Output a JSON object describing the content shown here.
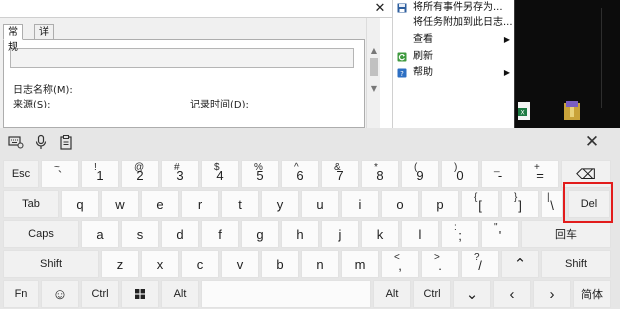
{
  "event_viewer": {
    "close_glyph": "✕",
    "tabs": [
      {
        "label": "常规",
        "active": true
      },
      {
        "label": "详细信息",
        "active": false
      }
    ],
    "fields": [
      {
        "label": "日志名称(M):"
      },
      {
        "label": "来源(S):"
      },
      {
        "label": "记录时间(D):"
      }
    ],
    "menu": [
      {
        "label": "将所有事件另存为...",
        "icon": "save-icon"
      },
      {
        "label": "将任务附加到此日志...",
        "icon": "none"
      },
      {
        "label": "查看",
        "icon": "none",
        "submenu": true
      },
      {
        "label": "刷新",
        "icon": "refresh-icon"
      },
      {
        "label": "帮助",
        "icon": "help-icon",
        "submenu": true
      }
    ]
  },
  "keyboard": {
    "close_glyph": "✕",
    "toolbar_icons": [
      "keyboard-settings-icon",
      "microphone-icon",
      "clipboard-icon"
    ],
    "rows": [
      [
        {
          "label": "Esc"
        },
        {
          "shift": "~",
          "label": "`"
        },
        {
          "shift": "!",
          "label": "1"
        },
        {
          "shift": "@",
          "label": "2"
        },
        {
          "shift": "#",
          "label": "3"
        },
        {
          "shift": "$",
          "label": "4"
        },
        {
          "shift": "%",
          "label": "5"
        },
        {
          "shift": "^",
          "label": "6"
        },
        {
          "shift": "&",
          "label": "7"
        },
        {
          "shift": "*",
          "label": "8"
        },
        {
          "shift": "(",
          "label": "9"
        },
        {
          "shift": ")",
          "label": "0"
        },
        {
          "shift": "_",
          "label": "-"
        },
        {
          "shift": "+",
          "label": "="
        },
        {
          "label": "⌫",
          "icon": "backspace-icon"
        }
      ],
      [
        {
          "label": "Tab"
        },
        {
          "label": "q"
        },
        {
          "label": "w"
        },
        {
          "label": "e"
        },
        {
          "label": "r"
        },
        {
          "label": "t"
        },
        {
          "label": "y"
        },
        {
          "label": "u"
        },
        {
          "label": "i"
        },
        {
          "label": "o"
        },
        {
          "label": "p"
        },
        {
          "shift": "{",
          "label": "["
        },
        {
          "shift": "}",
          "label": "]"
        },
        {
          "shift": "|",
          "label": "\\"
        },
        {
          "label": "Del"
        }
      ],
      [
        {
          "label": "Caps"
        },
        {
          "label": "a"
        },
        {
          "label": "s"
        },
        {
          "label": "d"
        },
        {
          "label": "f"
        },
        {
          "label": "g"
        },
        {
          "label": "h"
        },
        {
          "label": "j"
        },
        {
          "label": "k"
        },
        {
          "label": "l"
        },
        {
          "shift": ":",
          "label": ";"
        },
        {
          "shift": "\"",
          "label": "'"
        },
        {
          "label": "回车"
        }
      ],
      [
        {
          "label": "Shift"
        },
        {
          "label": "z"
        },
        {
          "label": "x"
        },
        {
          "label": "c"
        },
        {
          "label": "v"
        },
        {
          "label": "b"
        },
        {
          "label": "n"
        },
        {
          "label": "m"
        },
        {
          "shift": "<",
          "label": ","
        },
        {
          "shift": ">",
          "label": "."
        },
        {
          "shift": "?",
          "label": "/"
        },
        {
          "label": "⌃",
          "icon": "arrow-up-icon"
        },
        {
          "label": "Shift"
        }
      ],
      [
        {
          "label": "Fn"
        },
        {
          "label": "☺",
          "icon": "emoji-icon"
        },
        {
          "label": "Ctrl"
        },
        {
          "label": "",
          "icon": "windows-icon"
        },
        {
          "label": "Alt"
        },
        {
          "label": "",
          "icon": "space"
        },
        {
          "label": "Alt"
        },
        {
          "label": "Ctrl"
        },
        {
          "label": "⌄",
          "icon": "arrow-down-icon"
        },
        {
          "label": "‹",
          "icon": "arrow-left-icon"
        },
        {
          "label": "›",
          "icon": "arrow-right-icon"
        },
        {
          "label": "简体"
        }
      ]
    ]
  },
  "colors": {
    "highlight": "#e21c1c",
    "key_face": "#fbfbfb",
    "keyboard_bg": "#e6e6e6"
  }
}
